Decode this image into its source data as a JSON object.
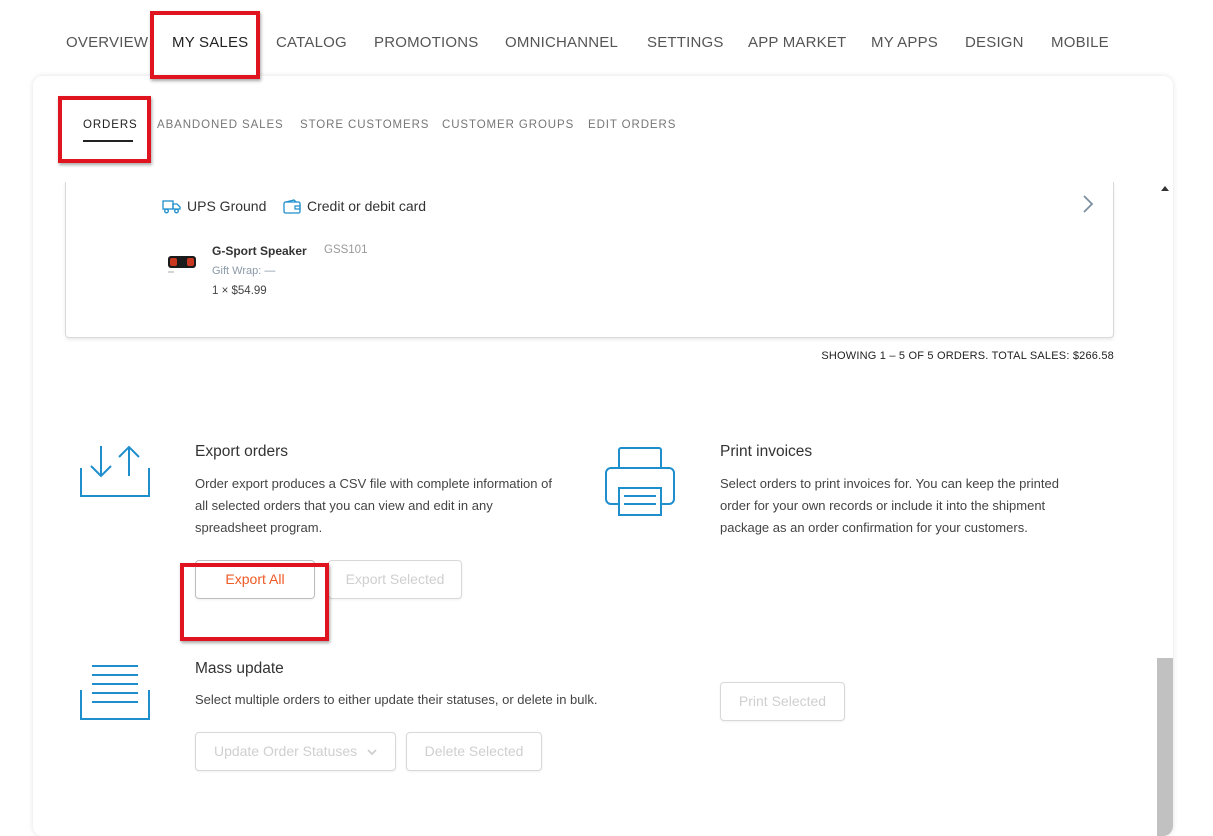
{
  "top_nav": {
    "items": [
      "OVERVIEW",
      "MY SALES",
      "CATALOG",
      "PROMOTIONS",
      "OMNICHANNEL",
      "SETTINGS",
      "APP MARKET",
      "MY APPS",
      "DESIGN",
      "MOBILE"
    ],
    "active": "MY SALES"
  },
  "sub_nav": {
    "items": [
      "ORDERS",
      "ABANDONED SALES",
      "STORE CUSTOMERS",
      "CUSTOMER GROUPS",
      "EDIT ORDERS"
    ],
    "active": "ORDERS"
  },
  "order": {
    "shipping_method": "UPS Ground",
    "payment_method": "Credit or debit card",
    "product_name": "G-Sport Speaker",
    "product_sku": "GSS101",
    "gift_wrap": "Gift Wrap: —",
    "qty_price": "1 × $54.99"
  },
  "summary": "SHOWING 1 – 5 OF 5 ORDERS. TOTAL SALES: $266.58",
  "export": {
    "title": "Export orders",
    "description": "Order export produces a CSV file with complete information of all selected orders that you can view and edit in any spreadsheet program.",
    "export_all_label": "Export All",
    "export_selected_label": "Export Selected",
    "icon": "export-icon"
  },
  "print": {
    "title": "Print invoices",
    "description": "Select orders to print invoices for. You can keep the printed order for your own records or include it into the shipment package as an order confirmation for your customers.",
    "print_selected_label": "Print Selected",
    "icon": "printer-icon"
  },
  "mass_update": {
    "title": "Mass update",
    "description": "Select multiple orders to either update their statuses, or delete in bulk.",
    "update_statuses_label": "Update Order Statuses",
    "delete_selected_label": "Delete Selected",
    "icon": "list-icon"
  },
  "colors": {
    "accent": "#ee5a24",
    "icon_blue": "#1e8ecc",
    "highlight_red": "#e0141e"
  }
}
